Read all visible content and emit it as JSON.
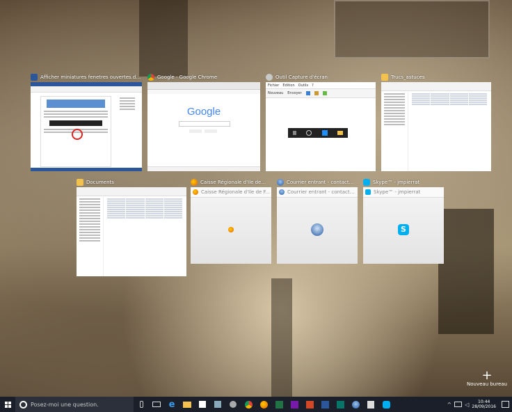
{
  "task_view": {
    "row1": [
      {
        "title": "Afficher miniatures fenetres ouvertes.do...",
        "app": "word",
        "icon": "word-icon"
      },
      {
        "title": "Google - Google Chrome",
        "app": "chrome",
        "icon": "chrome-icon",
        "page_logo": "Google"
      },
      {
        "title": "Outil Capture d'écran",
        "app": "snipping",
        "icon": "scissors-icon",
        "menu": [
          "Fichier",
          "Edition",
          "Outils",
          "?"
        ],
        "toolbar": [
          "Nouveau",
          "Envoyer"
        ]
      },
      {
        "title": "Trucs_astuces",
        "app": "explorer",
        "icon": "folder-icon"
      }
    ],
    "row2": [
      {
        "title": "Documents",
        "app": "explorer",
        "icon": "folder-icon"
      },
      {
        "title": "Caisse Régionale d'Ile de...",
        "app": "firefox",
        "icon": "firefox-icon",
        "inner_title": "Caisse Régionale d'Ile de F..."
      },
      {
        "title": "Courrier entrant - contact...",
        "app": "thunderbird",
        "icon": "thunderbird-icon",
        "inner_title": "Courrier entrant - contact@m..."
      },
      {
        "title": "Skype™ - jmpierrat",
        "app": "skype",
        "icon": "skype-icon",
        "inner_title": "Skype™ - jmpierrat"
      }
    ],
    "new_desktop_label": "Nouveau bureau"
  },
  "taskbar": {
    "search_placeholder": "Posez-moi une question.",
    "clock_time": "10:44",
    "clock_date": "28/09/2016"
  },
  "colors": {
    "taskbar": "#1b1f2a",
    "word": "#2b579a",
    "chrome_red": "#db4437",
    "firefox": "#e66000",
    "skype": "#00aff0",
    "folder": "#f2c14e"
  }
}
